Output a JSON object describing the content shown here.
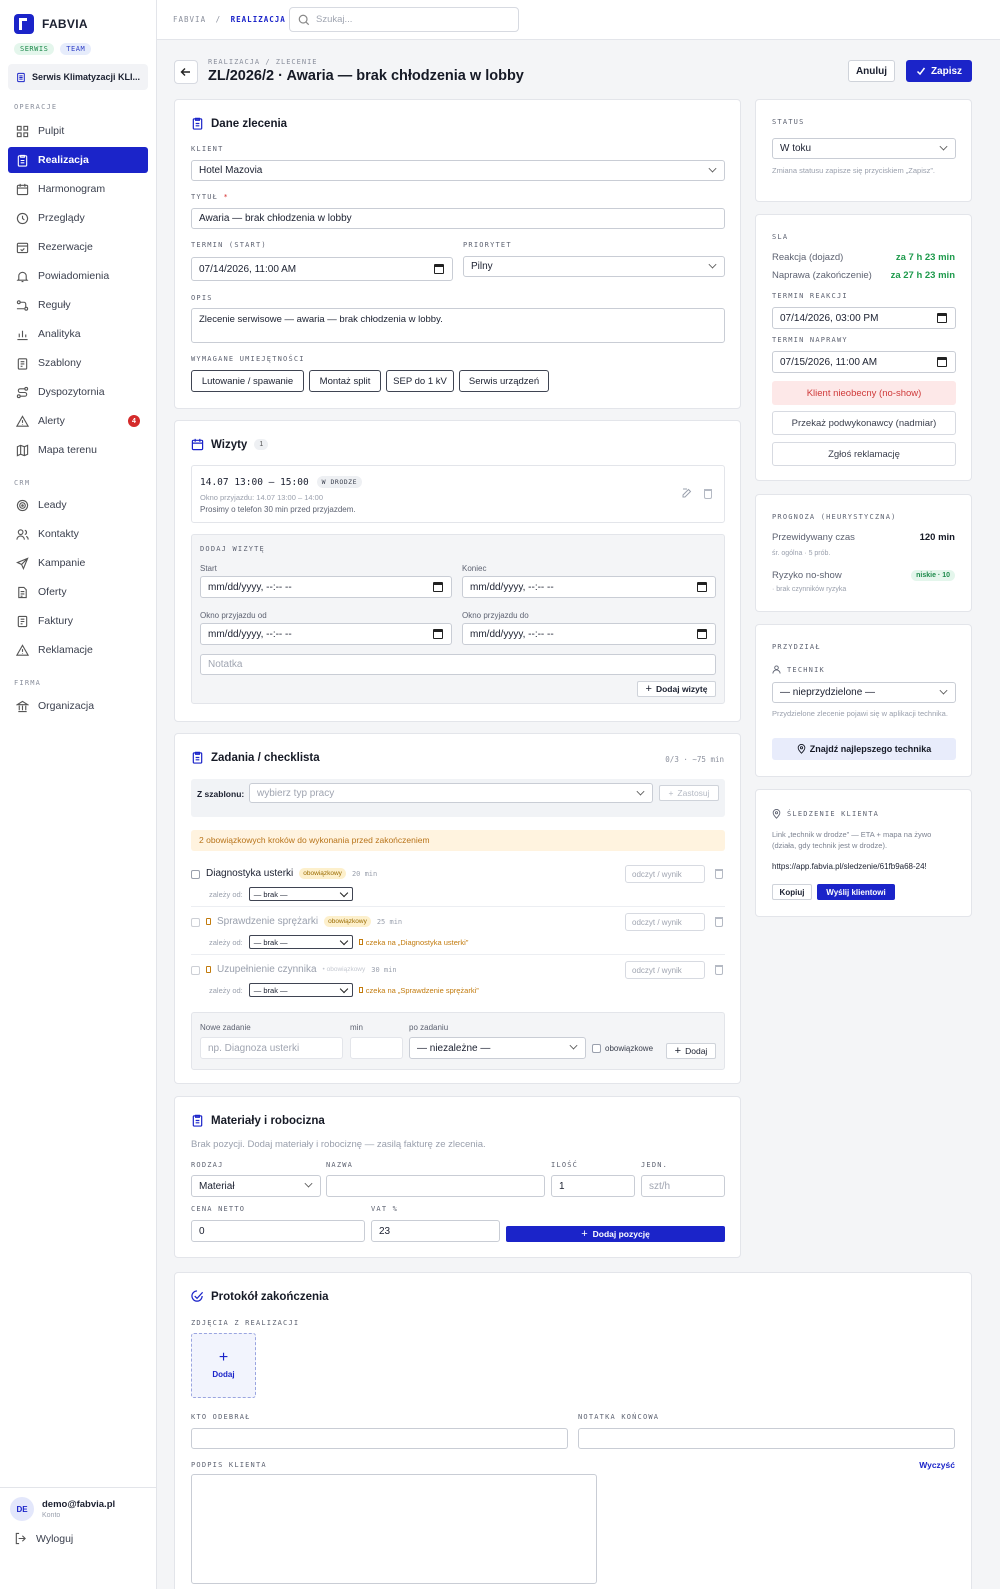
{
  "app": {
    "name": "FABVIA",
    "tag_serwis": "SERWIS",
    "tag_team": "TEAM",
    "org": "Serwis Klimatyzacji KLI..."
  },
  "sidebar": {
    "sec_operacje": "OPERACJE",
    "sec_crm": "CRM",
    "sec_firma": "FIRMA",
    "items": [
      {
        "label": "Pulpit"
      },
      {
        "label": "Realizacja"
      },
      {
        "label": "Harmonogram"
      },
      {
        "label": "Przeglądy"
      },
      {
        "label": "Rezerwacje"
      },
      {
        "label": "Powiadomienia"
      },
      {
        "label": "Reguły"
      },
      {
        "label": "Analityka"
      },
      {
        "label": "Szablony"
      },
      {
        "label": "Dyspozytornia"
      },
      {
        "label": "Alerty"
      },
      {
        "label": "Mapa terenu"
      },
      {
        "label": "Leady"
      },
      {
        "label": "Kontakty"
      },
      {
        "label": "Kampanie"
      },
      {
        "label": "Oferty"
      },
      {
        "label": "Faktury"
      },
      {
        "label": "Reklamacje"
      },
      {
        "label": "Organizacja"
      }
    ],
    "alerts_count": "4",
    "user_initials": "DE",
    "user_email": "demo@fabvia.pl",
    "user_role": "Konto",
    "logout": "Wyloguj"
  },
  "topbar": {
    "crumb_root": "FABVIA",
    "crumb_sep": "/",
    "crumb_current": "REALIZACJA",
    "search_placeholder": "Szukaj..."
  },
  "page": {
    "crumb": "REALIZACJA / ZLECENIE",
    "title": "ZL/2026/2 · Awaria — brak chłodzenia w lobby",
    "cancel": "Anuluj",
    "save": "Zapisz"
  },
  "dane": {
    "title": "Dane zlecenia",
    "klient_label": "KLIENT",
    "klient": "Hotel Mazovia",
    "tytul_label": "TYTUŁ",
    "required": "*",
    "tytul": "Awaria — brak chłodzenia w lobby",
    "termin_label": "TERMIN (START)",
    "termin": "07/14/2026, 11:00 AM",
    "priorytet_label": "PRIORYTET",
    "priorytet": "Pilny",
    "opis_label": "OPIS",
    "opis": "Zlecenie serwisowe — awaria — brak chłodzenia w lobby.",
    "skills_label": "WYMAGANE UMIEJĘTNOŚCI",
    "skills": [
      "Lutowanie / spawanie",
      "Montaż split",
      "SEP do 1 kV",
      "Serwis urządzeń"
    ]
  },
  "wizyty": {
    "title": "Wizyty",
    "count": "1",
    "visit_time": "14.07 13:00 – 15:00",
    "visit_status": "W DRODZE",
    "visit_window": "Okno przyjazdu: 14.07 13:00 – 14:00",
    "visit_note": "Prosimy o telefon 30 min przed przyjazdem.",
    "add_title": "DODAJ WIZYTĘ",
    "start": "Start",
    "koniec": "Koniec",
    "okno_od": "Okno przyjazdu od",
    "okno_do": "Okno przyjazdu do",
    "dt_placeholder": "mm/dd/yyyy, --:-- --",
    "notatka": "Notatka",
    "add_btn": "Dodaj wizytę"
  },
  "zadania": {
    "title": "Zadania / checklista",
    "summary": "0/3 · ~75 min",
    "szablon_label": "Z szablonu:",
    "szablon_placeholder": "wybierz typ pracy",
    "zastosuj": "Zastosuj",
    "warning": "2 obowiązkowych kroków do wykonania przed zakończeniem",
    "zalezy": "zależy od:",
    "brak": "— brak —",
    "result_placeholder": "odczyt / wynik",
    "tasks": [
      {
        "name": "Diagnostyka usterki",
        "req": "obowiązkowy",
        "min": "20 min",
        "wait": ""
      },
      {
        "name": "Sprawdzenie sprężarki",
        "req": "obowiązkowy",
        "min": "25 min",
        "wait": "czeka na „Diagnostyka usterki”"
      },
      {
        "name": "Uzupełnienie czynnika",
        "req": "• obowiązkowy",
        "min": "30 min",
        "wait": "czeka na „Sprawdzenie sprężarki”"
      }
    ],
    "new_label": "Nowe zadanie",
    "min_label": "min",
    "po_label": "po zadaniu",
    "new_placeholder": "np. Diagnoza usterki",
    "niezalezne": "— niezależne —",
    "obowiazkowe": "obowiązkowe",
    "dodaj": "Dodaj"
  },
  "materialy": {
    "title": "Materiały i robocizna",
    "empty": "Brak pozycji. Dodaj materiały i robociznę — zasilą fakturę ze zlecenia.",
    "rodzaj_label": "RODZAJ",
    "nazwa_label": "NAZWA",
    "ilosc_label": "ILOŚĆ",
    "jedn_label": "JEDN.",
    "rodzaj": "Materiał",
    "ilosc": "1",
    "jedn_placeholder": "szt/h",
    "cena_label": "CENA NETTO",
    "vat_label": "VAT %",
    "cena": "0",
    "vat": "23",
    "add": "Dodaj pozycję"
  },
  "protokol": {
    "title": "Protokół zakończenia",
    "zdjecia_label": "ZDJĘCIA Z REALIZACJI",
    "dodaj": "Dodaj",
    "kto_label": "KTO ODEBRAŁ",
    "notatka_label": "NOTATKA KOŃCOWA",
    "podpis_label": "PODPIS KLIENTA",
    "wyczysc": "Wyczyść"
  },
  "status": {
    "label": "STATUS",
    "value": "W toku",
    "hint": "Zmiana statusu zapisze się przyciskiem „Zapisz”."
  },
  "sla": {
    "label": "SLA",
    "reakcja": "Reakcja (dojazd)",
    "reakcja_val": "za 7 h 23 min",
    "naprawa": "Naprawa (zakończenie)",
    "naprawa_val": "za 27 h 23 min",
    "termin_reakcji_label": "TERMIN REAKCJI",
    "termin_reakcji": "07/14/2026, 03:00 PM",
    "termin_naprawy_label": "TERMIN NAPRAWY",
    "termin_naprawy": "07/15/2026, 11:00 AM",
    "noshow": "Klient nieobecny (no-show)",
    "podwykonawca": "Przekaż podwykonawcy (nadmiar)",
    "reklamacja": "Zgłoś reklamację"
  },
  "prognoza": {
    "label": "PROGNOZA (HEURYSTYCZNA)",
    "czas": "Przewidywany czas",
    "czas_val": "120 min",
    "czas_sub": "śr. ogólna · 5 prób.",
    "ryzyko": "Ryzyko no-show",
    "ryzyko_val": "niskie · 10",
    "ryzyko_sub": "· brak czynników ryzyka"
  },
  "przydzial": {
    "label": "PRZYDZIAŁ",
    "technik_label": "TECHNIK",
    "technik": "— nieprzydzielone —",
    "hint": "Przydzielone zlecenie pojawi się w aplikacji technika.",
    "find": "Znajdź najlepszego technika"
  },
  "sledzenie": {
    "label": "ŚLEDZENIE KLIENTA",
    "desc": "Link „technik w drodze” — ETA + mapa na żywo (działa, gdy technik jest w drodze).",
    "url": "https://app.fabvia.pl/sledzenie/61fb9a68-24!",
    "kopiuj": "Kopiuj",
    "wyslij": "Wyślij klientowi"
  },
  "colors": {
    "accent": "#1b24c9",
    "success": "#1e9a4c",
    "danger": "#cf3a3a"
  }
}
